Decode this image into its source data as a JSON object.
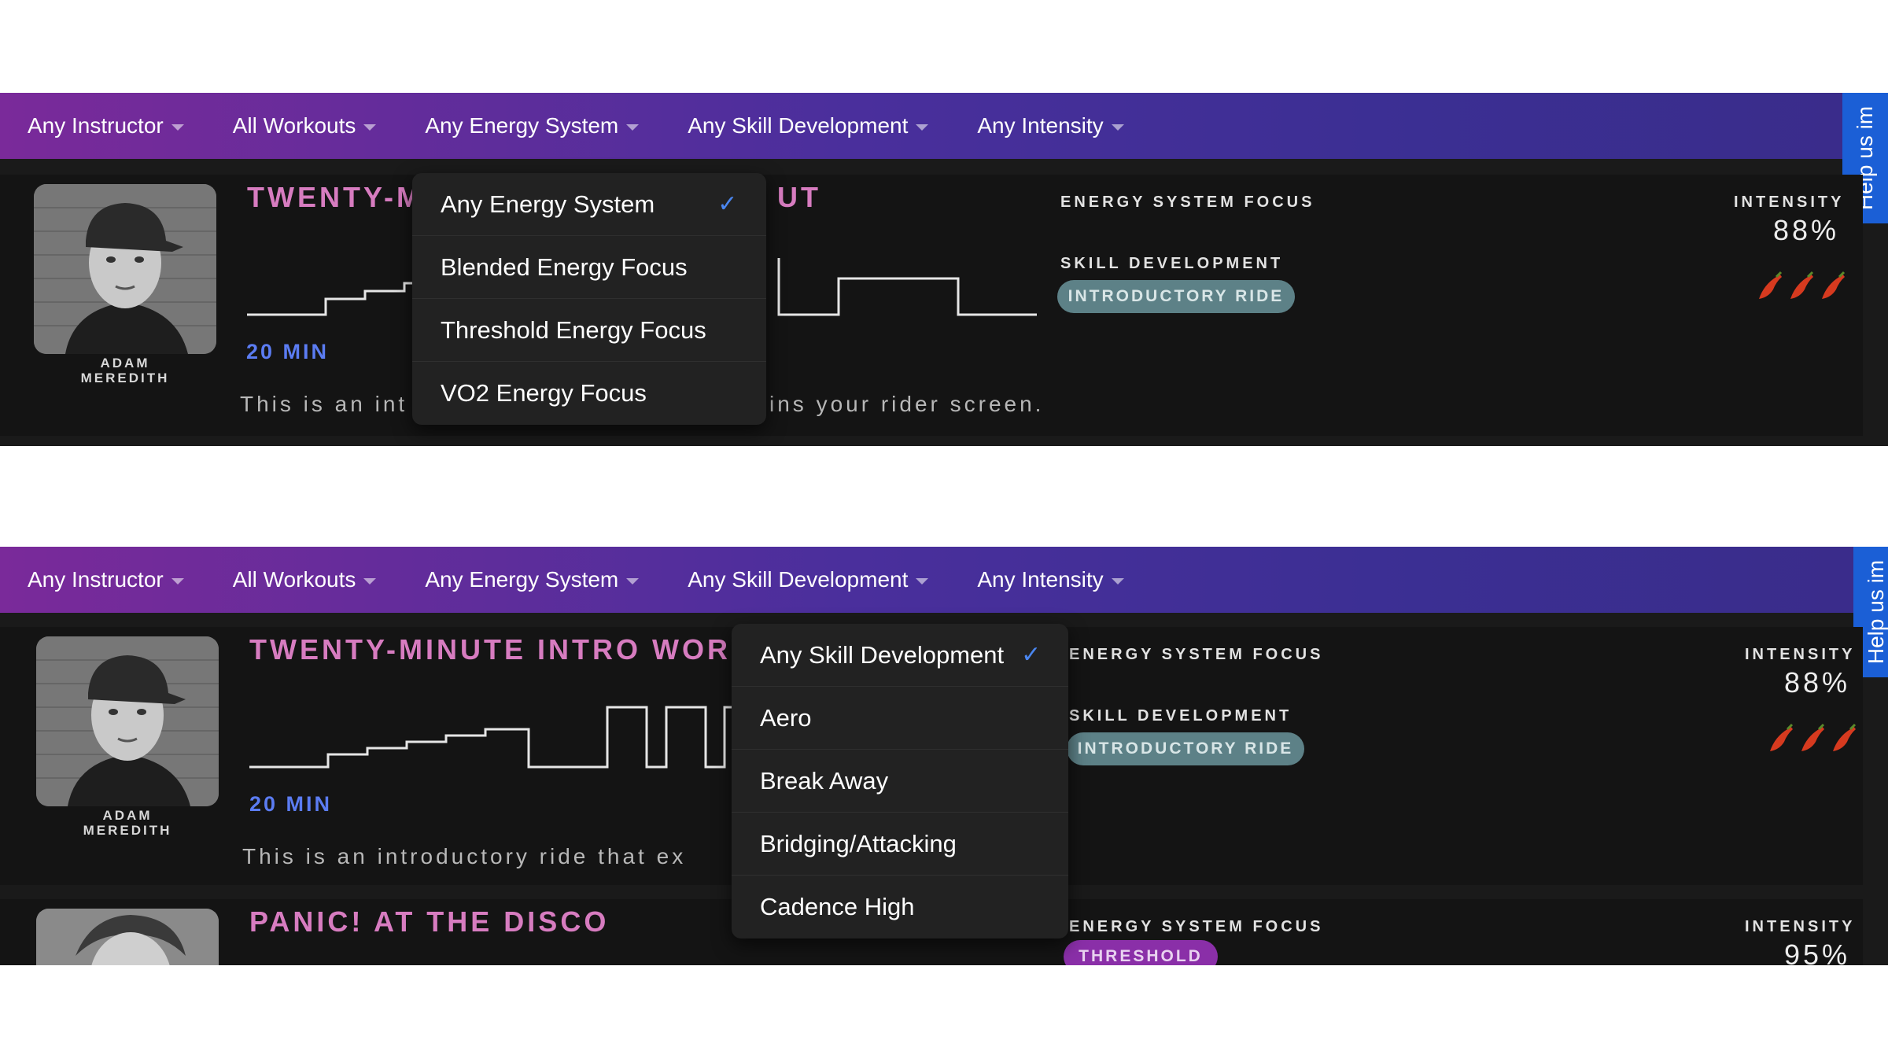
{
  "filters": {
    "instructor": "Any Instructor",
    "workouts": "All Workouts",
    "energy_system": "Any Energy System",
    "skill_development": "Any Skill Development",
    "intensity": "Any Intensity"
  },
  "help_tab": "Help us im",
  "workout_1": {
    "title_full": "TWENTY-MINUTE INTRO WOR",
    "title_left": "TWENTY-M",
    "title_right": "UT",
    "instructor_first": "ADAM",
    "instructor_last": "MEREDITH",
    "duration": "20 MIN",
    "description_full": "This is an introductory ride that ex",
    "description_left": "This is an int",
    "description_right": "ins your rider screen.",
    "energy_system_label": "ENERGY SYSTEM FOCUS",
    "skill_label": "SKILL DEVELOPMENT",
    "skill_pill": "INTRODUCTORY RIDE",
    "intensity_label": "INTENSITY",
    "intensity_value": "88%",
    "pepper_count": 3
  },
  "workout_2": {
    "title": "PANIC! AT THE DISCO",
    "energy_system_label": "ENERGY SYSTEM FOCUS",
    "energy_pill": "THRESHOLD",
    "intensity_label": "INTENSITY",
    "intensity_value": "95%"
  },
  "energy_dropdown": {
    "options": [
      "Any Energy System",
      "Blended Energy Focus",
      "Threshold Energy Focus",
      "VO2 Energy Focus"
    ],
    "selected": "Any Energy System"
  },
  "skill_dropdown": {
    "options": [
      "Any Skill Development",
      "Aero",
      "Break Away",
      "Bridging/Attacking",
      "Cadence High"
    ],
    "selected": "Any Skill Development"
  },
  "colors": {
    "bar_gradient_start": "#7a2a9a",
    "bar_gradient_end": "#3a2c8a",
    "title_pink": "#d77cc0",
    "duration_blue": "#5b7cf2",
    "pill_teal": "#5d8187",
    "pill_purple": "#8a2fa8",
    "help_blue": "#1b5fd6",
    "check_blue": "#4a86f0",
    "pepper_red": "#d63a1f"
  },
  "icons": {
    "caret": "chevron-down-icon",
    "check": "checkmark-icon",
    "pepper": "chili-pepper-icon"
  }
}
